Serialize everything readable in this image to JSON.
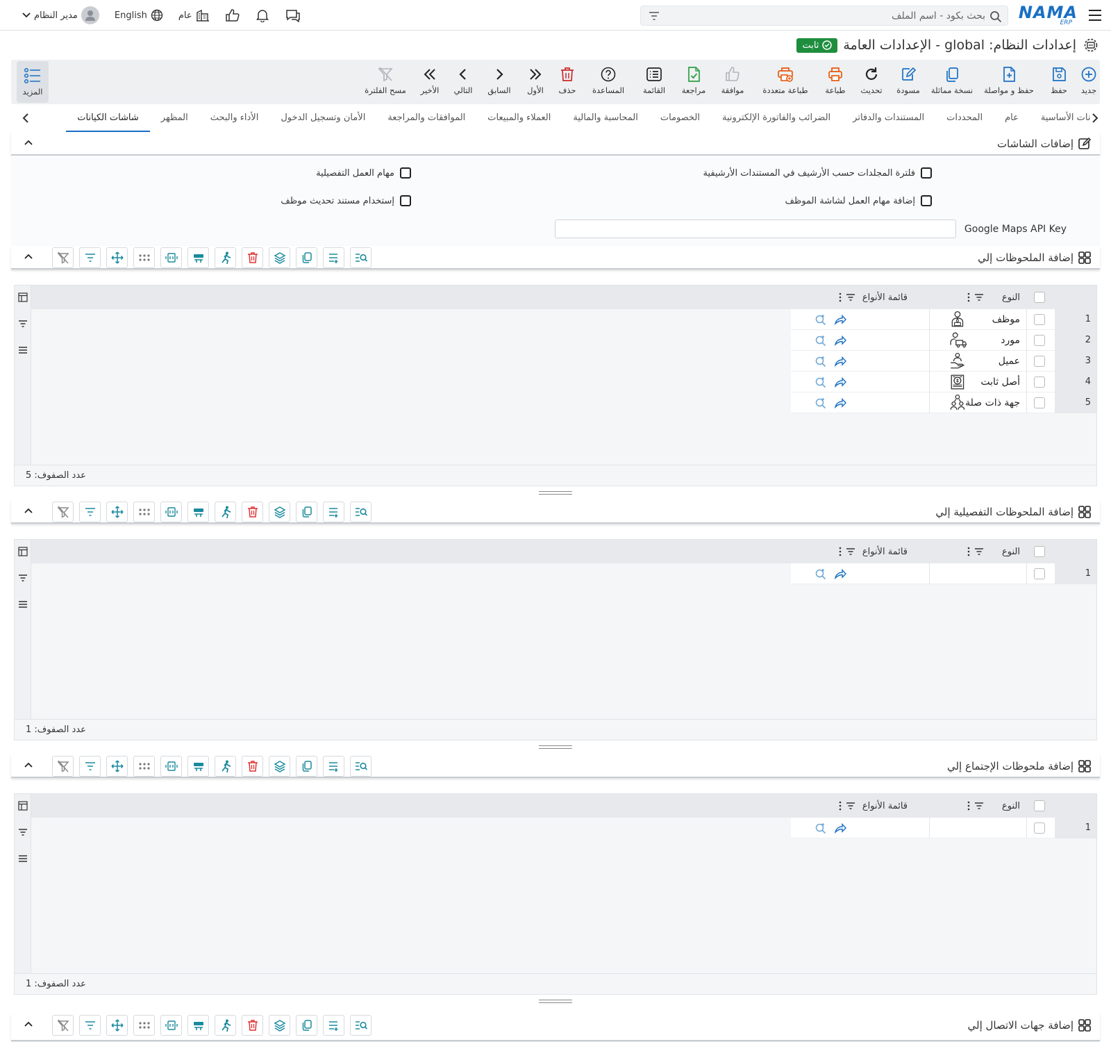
{
  "topbar": {
    "brand": "NAMA",
    "brand_sub": "ERP",
    "search_placeholder": "بحث بكود - اسم الملف",
    "language": "English",
    "branch": "عام",
    "user": "مدير النظام"
  },
  "page": {
    "title": "إعدادات النظام: global - الإعدادات العامة",
    "status": "ثابت"
  },
  "toolbar": {
    "buttons": [
      {
        "label": "جديد",
        "icon": "plus-circle-icon",
        "color": "#1a6fc4"
      },
      {
        "label": "حفظ",
        "icon": "save-icon",
        "color": "#1a6fc4"
      },
      {
        "label": "حفظ و مواصلة",
        "icon": "save-continue-icon",
        "color": "#1a6fc4"
      },
      {
        "label": "نسخة مماثلة",
        "icon": "copy-icon",
        "color": "#1a6fc4"
      },
      {
        "label": "مسودة",
        "icon": "draft-icon",
        "color": "#1a6fc4"
      },
      {
        "label": "تحديث",
        "icon": "refresh-icon",
        "color": "#222222"
      },
      {
        "label": "طباعة",
        "icon": "print-icon",
        "color": "#e8590c"
      },
      {
        "label": "طباعة متعددة",
        "icon": "multi-print-icon",
        "color": "#e8590c"
      },
      {
        "label": "موافقة",
        "icon": "thumbs-up-icon",
        "color": "#b0b4b9"
      },
      {
        "label": "مراجعة",
        "icon": "review-icon",
        "color": "#2f9e44"
      },
      {
        "label": "القائمة",
        "icon": "list-icon",
        "color": "#222222"
      },
      {
        "label": "المساعدة",
        "icon": "help-icon",
        "color": "#222222"
      },
      {
        "label": "حذف",
        "icon": "trash-icon",
        "color": "#c92a2a"
      },
      {
        "label": "الأول",
        "icon": "first-icon",
        "color": "#222222"
      },
      {
        "label": "السابق",
        "icon": "prev-icon",
        "color": "#222222"
      },
      {
        "label": "التالي",
        "icon": "next-icon",
        "color": "#222222"
      },
      {
        "label": "الأخير",
        "icon": "last-icon",
        "color": "#222222"
      },
      {
        "label": "مسح الفلترة",
        "icon": "clear-filter-icon",
        "color": "#b0b4b9"
      }
    ],
    "more_label": "المزيد"
  },
  "tabs": [
    "بيانات الأساسية",
    "عام",
    "المحددات",
    "المستندات والدفاتر",
    "الضرائب والفاتورة الإلكترونية",
    "الخصومات",
    "المحاسبة والمالية",
    "العملاء والمبيعات",
    "الموافقات والمراجعة",
    "الأمان وتسجيل الدخول",
    "الأداء والبحث",
    "المظهر",
    "شاشات الكيانات"
  ],
  "active_tab": "شاشات الكيانات",
  "screens_section": {
    "title": "إضافات الشاشات",
    "checkboxes": [
      {
        "label": "فلترة المجلدات حسب الأرشيف في المستندات الأرشيفية",
        "checked": false
      },
      {
        "label": "مهام العمل التفصيلية",
        "checked": false
      },
      {
        "label": "إضافة مهام العمل لشاشة الموظف",
        "checked": false
      },
      {
        "label": "إستخدام مستند تحديث موظف",
        "checked": false
      }
    ],
    "gmaps_label": "Google Maps API Key",
    "gmaps_value": ""
  },
  "columns": {
    "type": "النوع",
    "types_list": "قائمة الأنواع"
  },
  "grids": [
    {
      "title": "إضافة الملحوظات إلي",
      "rows": [
        {
          "num": "1",
          "type": "موظف",
          "icon": "employee-icon"
        },
        {
          "num": "2",
          "type": "مورد",
          "icon": "supplier-icon"
        },
        {
          "num": "3",
          "type": "عميل",
          "icon": "customer-icon"
        },
        {
          "num": "4",
          "type": "أصل ثابت",
          "icon": "fixed-asset-icon"
        },
        {
          "num": "5",
          "type": "جهة ذات صلة",
          "icon": "related-party-icon"
        }
      ],
      "count_label": "عدد الصفوف: 5"
    },
    {
      "title": "إضافة الملحوظات التفصيلية إلي",
      "rows": [
        {
          "num": "1",
          "type": "",
          "icon": ""
        }
      ],
      "count_label": "عدد الصفوف: 1"
    },
    {
      "title": "إضافة ملحوظات الإجتماع إلي",
      "rows": [
        {
          "num": "1",
          "type": "",
          "icon": ""
        }
      ],
      "count_label": "عدد الصفوف: 1"
    }
  ],
  "last_section": {
    "title": "إضافة جهات الاتصال إلي"
  },
  "colors": {
    "accent": "#1a6fc4",
    "teal": "#1a8a9e",
    "success": "#1e8e3e",
    "danger": "#e03131"
  }
}
